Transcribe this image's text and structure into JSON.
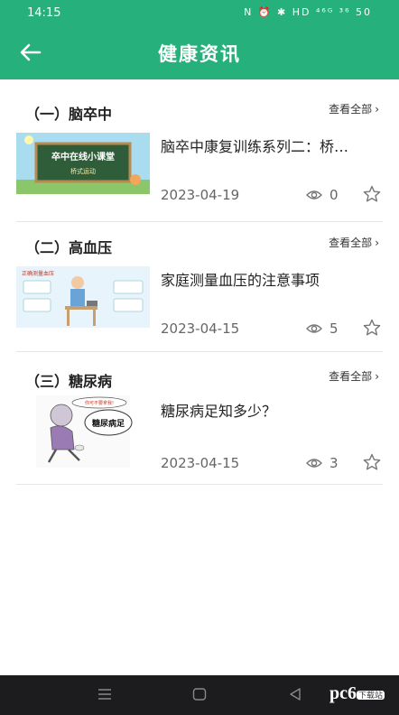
{
  "status_bar": {
    "time": "14:15",
    "icons_text": "N ⏰ ✱ HD ⁴⁶ᴳ ³⁶ 50"
  },
  "header": {
    "title": "健康资讯"
  },
  "sections": [
    {
      "title": "（一）脑卒中",
      "more": "查看全部",
      "item": {
        "title": "脑卒中康复训练系列二：桥…",
        "date": "2023-04-19",
        "views": "0",
        "thumb_text": "卒中在线小课堂",
        "thumb_sub": "桥式运动"
      }
    },
    {
      "title": "（二）高血压",
      "more": "查看全部",
      "item": {
        "title": "家庭测量血压的注意事项",
        "date": "2023-04-15",
        "views": "5",
        "thumb_text": "正确测量血压"
      }
    },
    {
      "title": "（三）糖尿病",
      "more": "查看全部",
      "item": {
        "title": "糖尿病足知多少？",
        "date": "2023-04-15",
        "views": "3",
        "thumb_text": "糖尿病足",
        "thumb_bubble": "你可不要拿我!"
      }
    }
  ],
  "watermark": {
    "text": "pc6",
    "sub": "下载站"
  },
  "colors": {
    "accent": "#26b07b",
    "nav": "#1c1c1e"
  }
}
